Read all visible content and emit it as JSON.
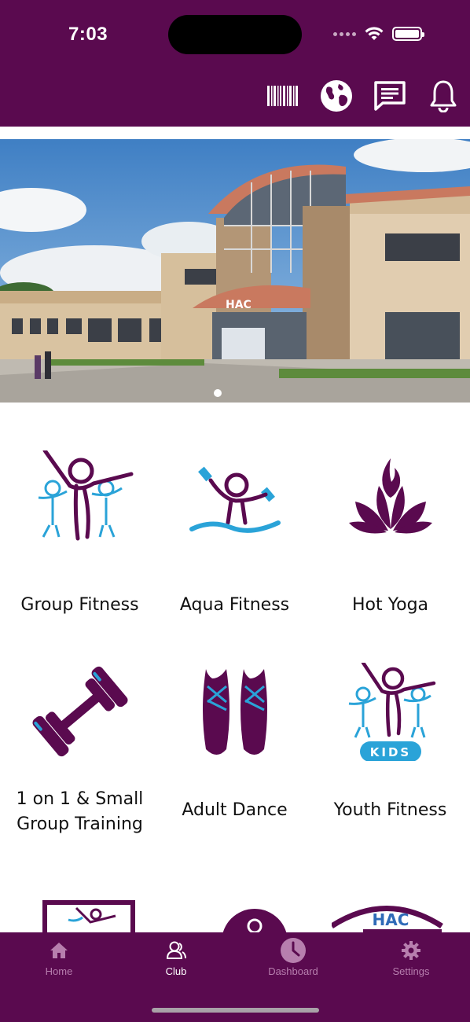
{
  "status_bar": {
    "time": "7:03"
  },
  "header": {
    "icons": [
      "barcode-icon",
      "globe-icon",
      "message-icon",
      "bell-icon"
    ]
  },
  "banner": {
    "sign_text": "HAC",
    "page_count": 1,
    "active_page": 1
  },
  "tiles": [
    {
      "label": "Group Fitness",
      "icon": "group-fitness-icon"
    },
    {
      "label": "Aqua Fitness",
      "icon": "aqua-fitness-icon"
    },
    {
      "label": "Hot Yoga",
      "icon": "lotus-flame-icon"
    },
    {
      "label_line1": "1 on 1 & Small",
      "label_line2": "Group Training",
      "icon": "dumbbell-icon"
    },
    {
      "label": "Adult Dance",
      "icon": "ballet-shoes-icon"
    },
    {
      "label": "Youth Fitness",
      "icon": "kids-fitness-icon",
      "badge": "KIDS"
    }
  ],
  "partial_tiles": {
    "third_sign": "HAC"
  },
  "tabbar": {
    "tabs": [
      {
        "label": "Home",
        "icon": "home-icon",
        "active": false
      },
      {
        "label": "Club",
        "icon": "club-icon",
        "active": true
      },
      {
        "label": "Dashboard",
        "icon": "clock-icon",
        "active": false
      },
      {
        "label": "Settings",
        "icon": "gear-icon",
        "active": false
      }
    ]
  },
  "colors": {
    "brand": "#5a0a4f",
    "accent": "#2aa3d8",
    "tab_inactive": "#b77fae"
  }
}
